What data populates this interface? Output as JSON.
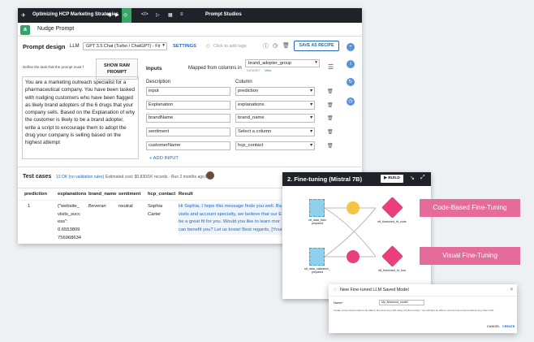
{
  "topbar": {
    "project": "Optimizing HCP Marketing Strategies",
    "center": "Prompt Studios"
  },
  "recipe": {
    "icon_letter": "a",
    "title": "Nudge Prompt"
  },
  "design": {
    "title": "Prompt design",
    "llm_label": "LLM",
    "llm_value": "GPT 3.5 Chat (Turbo / ChatGPT) - Fir",
    "settings": "SETTINGS",
    "tags_placeholder": "Click to add tags",
    "save_button": "SAVE AS RECIPE",
    "define_task": "Define the task that the prompt must f",
    "show_raw": [
      "SHOW RAW",
      "PROMPT"
    ],
    "prompt_text": "You are a marketing outreach specialist for a pharmaceutical company. You have been tasked with nudging customers who have been flagged as likely brand adopters of the 6 drugs that your company sells.  Based on the Explanation of why the customer is likely to be a brand adopter, write a script to encourage them to adopt the drug your company is selling based on the highest attempt",
    "inputs_label": "Inputs",
    "mapped_label": "Mapped from columns in",
    "dataset_select": "brand_adopter_group",
    "dataset_sub": "DATASET",
    "dataset_view": "View",
    "col_description": "Description",
    "col_column": "Column",
    "rows": [
      {
        "description": "input",
        "column": "prediction"
      },
      {
        "description": "Explanation",
        "column": "explanations"
      },
      {
        "description": "brandName",
        "column": "brand_name"
      },
      {
        "description": "sentiment",
        "column": "Select a column"
      },
      {
        "description": "customerName",
        "column": "hcp_contact"
      }
    ],
    "add_input": "+ ADD INPUT"
  },
  "tests": {
    "title": "Test cases",
    "count_link": "13 OK (no validation rules)",
    "cost": "· Estimated cost: $0.830/1K records · Run 2 months ago by",
    "columns": [
      "prediction",
      "explanations",
      "brand_name",
      "sentiment",
      "hcp_contact",
      "Result"
    ],
    "row": {
      "prediction": "1",
      "explanations": [
        "{\"website_",
        "visits_succ",
        "ess\":",
        "0.6553809",
        "756968634"
      ],
      "brand_name": "Beveran",
      "sentiment": "neutral",
      "hcp_contact": [
        "Sophia",
        "Carter"
      ],
      "result": [
        "Hi Sophia, I hope this message finds you well. Ba",
        "visits and account specialty, we believe that our E",
        "be a great fit for you. Would you like to learn mor",
        "can benefit you? Let us know! Best regards, [Your"
      ]
    }
  },
  "flow": {
    "title": "2. Fine-tuning (Mistral 7B)",
    "build": "BUILD",
    "nodes": {
      "ds1": [
        "sft_data_train",
        "prepared"
      ],
      "ds2": [
        "sft_data_validation_",
        "prepared"
      ],
      "rec1": "sft_finetuned_hf_code",
      "rec2": "sft_finetuned_hf_lora"
    }
  },
  "labels": {
    "code_based": "Code-Based Fine-Tuning",
    "visual": "Visual Fine-Tuning"
  },
  "modal": {
    "title": "New Fine-tuned LLM Saved Model",
    "name_label": "Name*",
    "name_value": "My_finetuned_model",
    "help": "Create a fine-tuned model to be able to fine-tune any LLM using a Python recipe. You will then be able to use the fine-tuned model as any other LLM.",
    "cancel": "CANCEL",
    "create": "CREATE"
  },
  "colors": {
    "accent_green": "#36a765",
    "accent_blue": "#2668b8",
    "pink": "#e56b9a",
    "recipe_pink": "#ea3f7c",
    "dataset_blue": "#8fd0ec"
  }
}
